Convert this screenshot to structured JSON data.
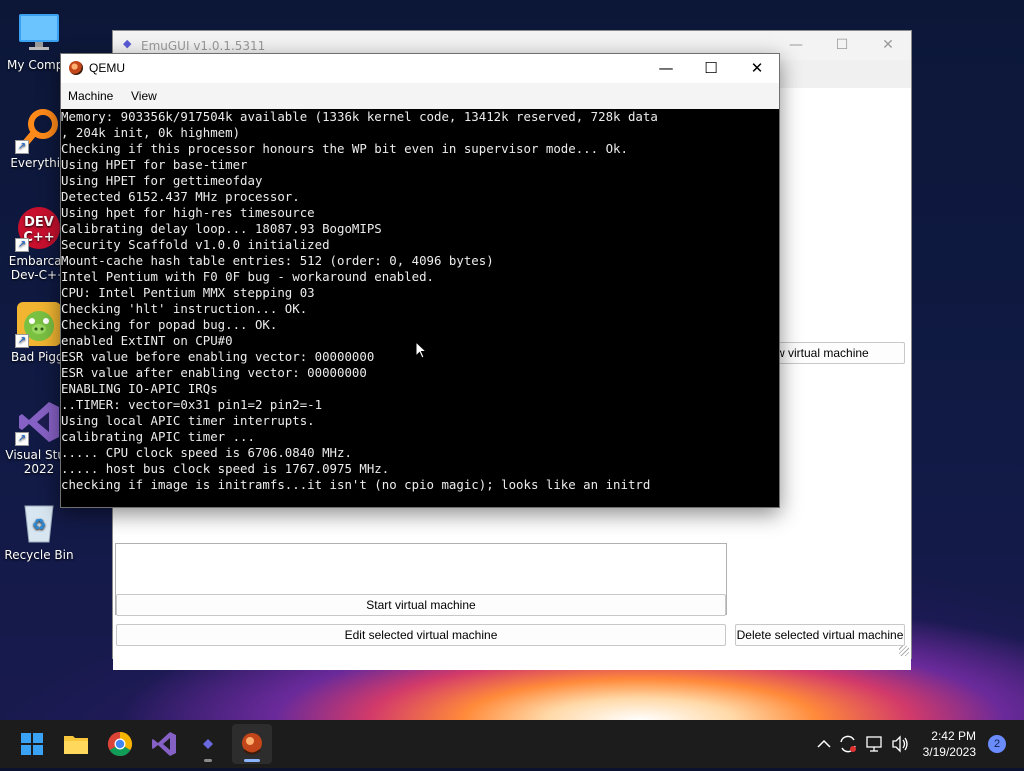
{
  "desktop": {
    "icons": [
      {
        "label": "My Compu",
        "icon": "this-pc-icon"
      },
      {
        "label": "Everythin",
        "icon": "everything-search-icon"
      },
      {
        "label": "Embarcad",
        "label2": "Dev-C++",
        "icon": "devcpp-icon"
      },
      {
        "label": "Bad Piggi",
        "icon": "bad-piggies-icon"
      },
      {
        "label": "Visual Stud",
        "label2": "2022",
        "icon": "visual-studio-icon"
      },
      {
        "label": "Recycle Bin",
        "icon": "recycle-bin-icon"
      }
    ]
  },
  "emugui": {
    "title": "EmuGUI v1.0.1.5311",
    "partial_button": "w virtual machine",
    "start_button": "Start virtual machine",
    "edit_button": "Edit selected virtual machine",
    "delete_button": "Delete selected virtual machine",
    "controls": {
      "minimize": "—",
      "maximize": "☐",
      "close": "✕"
    }
  },
  "qemu": {
    "title": "QEMU",
    "menu": [
      "Machine",
      "View"
    ],
    "controls": {
      "minimize": "—",
      "maximize": "☐",
      "close": "✕"
    },
    "console_lines": [
      "Memory: 903356k/917504k available (1336k kernel code, 13412k reserved, 728k data",
      ", 204k init, 0k highmem)",
      "Checking if this processor honours the WP bit even in supervisor mode... Ok.",
      "Using HPET for base-timer",
      "Using HPET for gettimeofday",
      "Detected 6152.437 MHz processor.",
      "Using hpet for high-res timesource",
      "Calibrating delay loop... 18087.93 BogoMIPS",
      "Security Scaffold v1.0.0 initialized",
      "Mount-cache hash table entries: 512 (order: 0, 4096 bytes)",
      "Intel Pentium with F0 0F bug - workaround enabled.",
      "CPU: Intel Pentium MMX stepping 03",
      "Checking 'hlt' instruction... OK.",
      "Checking for popad bug... OK.",
      "enabled ExtINT on CPU#0",
      "ESR value before enabling vector: 00000000",
      "ESR value after enabling vector: 00000000",
      "ENABLING IO-APIC IRQs",
      "..TIMER: vector=0x31 pin1=2 pin2=-1",
      "Using local APIC timer interrupts.",
      "calibrating APIC timer ...",
      "..... CPU clock speed is 6706.0840 MHz.",
      "..... host bus clock speed is 1767.0975 MHz.",
      "checking if image is initramfs...it isn't (no cpio magic); looks like an initrd"
    ]
  },
  "taskbar": {
    "apps": [
      "start-icon",
      "file-explorer-icon",
      "chrome-icon",
      "visual-studio-icon",
      "emugui-icon",
      "qemu-icon"
    ],
    "time": "2:42 PM",
    "date": "3/19/2023",
    "notifications": "2"
  }
}
